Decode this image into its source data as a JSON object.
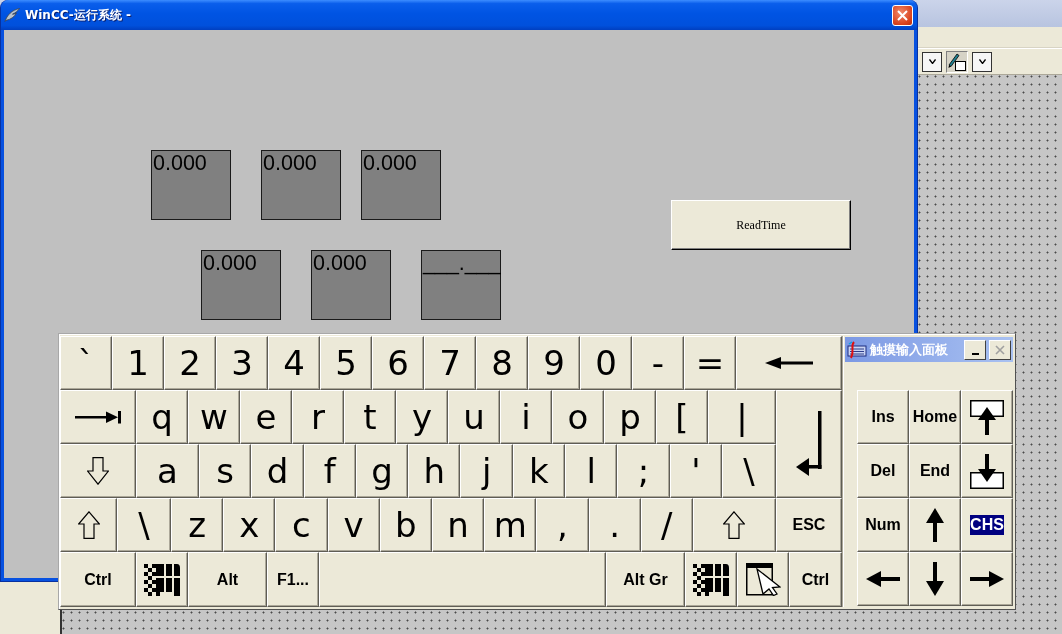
{
  "window": {
    "title": "WinCC-运行系统 -"
  },
  "io_fields": [
    {
      "value": "0.000"
    },
    {
      "value": "0.000"
    },
    {
      "value": "0.000"
    },
    {
      "value": "0.000"
    },
    {
      "value": "0.000"
    },
    {
      "value": "___.___"
    }
  ],
  "read_button": {
    "label": "ReadTime"
  },
  "keyboard": {
    "rows": [
      {
        "keys": [
          {
            "kind": "char",
            "label": "`"
          },
          {
            "kind": "char",
            "label": "1"
          },
          {
            "kind": "char",
            "label": "2"
          },
          {
            "kind": "char",
            "label": "3"
          },
          {
            "kind": "char",
            "label": "4"
          },
          {
            "kind": "char",
            "label": "5"
          },
          {
            "kind": "char",
            "label": "6"
          },
          {
            "kind": "char",
            "label": "7"
          },
          {
            "kind": "char",
            "label": "8"
          },
          {
            "kind": "char",
            "label": "9"
          },
          {
            "kind": "char",
            "label": "0"
          },
          {
            "kind": "char",
            "label": "-"
          },
          {
            "kind": "char",
            "label": "="
          },
          {
            "kind": "backspace"
          }
        ]
      },
      {
        "keys": [
          {
            "kind": "tab"
          },
          {
            "kind": "char",
            "label": "q"
          },
          {
            "kind": "char",
            "label": "w"
          },
          {
            "kind": "char",
            "label": "e"
          },
          {
            "kind": "char",
            "label": "r"
          },
          {
            "kind": "char",
            "label": "t"
          },
          {
            "kind": "char",
            "label": "y"
          },
          {
            "kind": "char",
            "label": "u"
          },
          {
            "kind": "char",
            "label": "i"
          },
          {
            "kind": "char",
            "label": "o"
          },
          {
            "kind": "char",
            "label": "p"
          },
          {
            "kind": "char",
            "label": "["
          },
          {
            "kind": "char",
            "label": "|"
          },
          {
            "kind": "enter"
          }
        ]
      },
      {
        "keys": [
          {
            "kind": "caps"
          },
          {
            "kind": "char",
            "label": "a"
          },
          {
            "kind": "char",
            "label": "s"
          },
          {
            "kind": "char",
            "label": "d"
          },
          {
            "kind": "char",
            "label": "f"
          },
          {
            "kind": "char",
            "label": "g"
          },
          {
            "kind": "char",
            "label": "h"
          },
          {
            "kind": "char",
            "label": "j"
          },
          {
            "kind": "char",
            "label": "k"
          },
          {
            "kind": "char",
            "label": "l"
          },
          {
            "kind": "char",
            "label": ";"
          },
          {
            "kind": "char",
            "label": "'"
          },
          {
            "kind": "char",
            "label": "\\"
          }
        ]
      },
      {
        "keys": [
          {
            "kind": "shift"
          },
          {
            "kind": "char",
            "label": "\\"
          },
          {
            "kind": "char",
            "label": "z"
          },
          {
            "kind": "char",
            "label": "x"
          },
          {
            "kind": "char",
            "label": "c"
          },
          {
            "kind": "char",
            "label": "v"
          },
          {
            "kind": "char",
            "label": "b"
          },
          {
            "kind": "char",
            "label": "n"
          },
          {
            "kind": "char",
            "label": "m"
          },
          {
            "kind": "char",
            "label": ","
          },
          {
            "kind": "char",
            "label": "."
          },
          {
            "kind": "char",
            "label": "/"
          },
          {
            "kind": "shift"
          },
          {
            "kind": "text",
            "label": "ESC"
          }
        ]
      },
      {
        "keys": [
          {
            "kind": "text",
            "label": "Ctrl"
          },
          {
            "kind": "windows"
          },
          {
            "kind": "text",
            "label": "Alt"
          },
          {
            "kind": "text",
            "label": "F1..."
          },
          {
            "kind": "space"
          },
          {
            "kind": "text",
            "label": "Alt Gr"
          },
          {
            "kind": "windows"
          },
          {
            "kind": "menu"
          },
          {
            "kind": "text",
            "label": "Ctrl"
          }
        ]
      }
    ],
    "panel": {
      "title": "触摸输入面板",
      "close_disabled": true
    },
    "nav_keys": [
      {
        "kind": "text",
        "label": "Ins",
        "active": false
      },
      {
        "kind": "text",
        "label": "Home",
        "active": false
      },
      {
        "kind": "pageup",
        "active": false
      },
      {
        "kind": "text",
        "label": "Del",
        "active": false
      },
      {
        "kind": "text",
        "label": "End",
        "active": false
      },
      {
        "kind": "pagedown",
        "active": false
      },
      {
        "kind": "text",
        "label": "Num",
        "active": false
      },
      {
        "kind": "up",
        "active": false
      },
      {
        "kind": "text",
        "label": "CHS",
        "active": true
      },
      {
        "kind": "left",
        "active": false
      },
      {
        "kind": "down",
        "active": false
      },
      {
        "kind": "right",
        "active": false
      }
    ]
  },
  "designer_toolbar": [
    {
      "kind": "dropdown"
    },
    {
      "kind": "tool"
    },
    {
      "kind": "dropdown"
    }
  ]
}
